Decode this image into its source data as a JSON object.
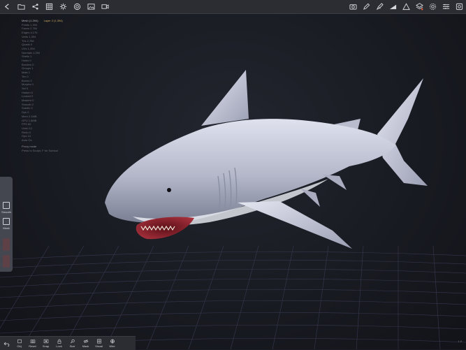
{
  "toolbar": {
    "left_icons": [
      "back-arrow-icon",
      "folder-icon",
      "share-icon",
      "grid-icon",
      "gear-icon",
      "target-icon",
      "image-icon",
      "video-camera-icon"
    ],
    "right_icons": [
      "camera-icon",
      "pencil-icon",
      "brush-icon",
      "gradient-icon",
      "triangle-icon",
      "layers-icon",
      "settings-icon",
      "sliders-icon",
      "snapshot-icon"
    ]
  },
  "stats": {
    "mesh": "Mesh (1,394)",
    "layer": "Layer 2 (1,394)",
    "rows": [
      "Points 1,394",
      "Faces 2,784",
      "Edges 4,176",
      "Verts 1,394",
      "Tris 2,784",
      "Quads 0",
      "UVs 1,394",
      "Normals 1,394",
      "Shells 1",
      "Holes 0",
      "Borders 0",
      "Groups 1",
      "Mats 1",
      "Tex 0",
      "Bones 0",
      "Morphs 0",
      "Sel 0",
      "Hidden 0",
      "Locked 0",
      "Masked 0",
      "Smooth 2",
      "Subdiv 0",
      "Dyn 0",
      "Mem 2.1MB",
      "GPU 1.8MB",
      "FPS 60",
      "Undo 12",
      "Redo 0",
      "Ops 14",
      "Auto On"
    ],
    "footer_1": "Proxy mode",
    "footer_2": "Press to Sculpt, F for Subtool"
  },
  "left_panel": {
    "items": [
      {
        "label": "Smooth",
        "icon": "smooth-icon"
      },
      {
        "label": "Mask",
        "icon": "mask-icon"
      }
    ]
  },
  "bottom_bar": {
    "undo_icon": "undo-icon",
    "items": [
      {
        "label": "Obj",
        "icon": "object-icon"
      },
      {
        "label": "Reset",
        "icon": "camera-reset-icon"
      },
      {
        "label": "Snap",
        "icon": "snapshot-icon"
      },
      {
        "label": "Lock",
        "icon": "lock-icon"
      },
      {
        "label": "Size",
        "icon": "zoom-icon"
      },
      {
        "label": "Mask",
        "icon": "eye-slash-icon"
      },
      {
        "label": "Visual",
        "icon": "grid-icon"
      },
      {
        "label": "Wire",
        "icon": "globe-icon"
      }
    ]
  },
  "corner_text": "1.0",
  "colors": {
    "bar": "#2b2d33",
    "background": "#1b1d24",
    "grid": "#3a3a52",
    "shark": "#c4c8d8"
  }
}
